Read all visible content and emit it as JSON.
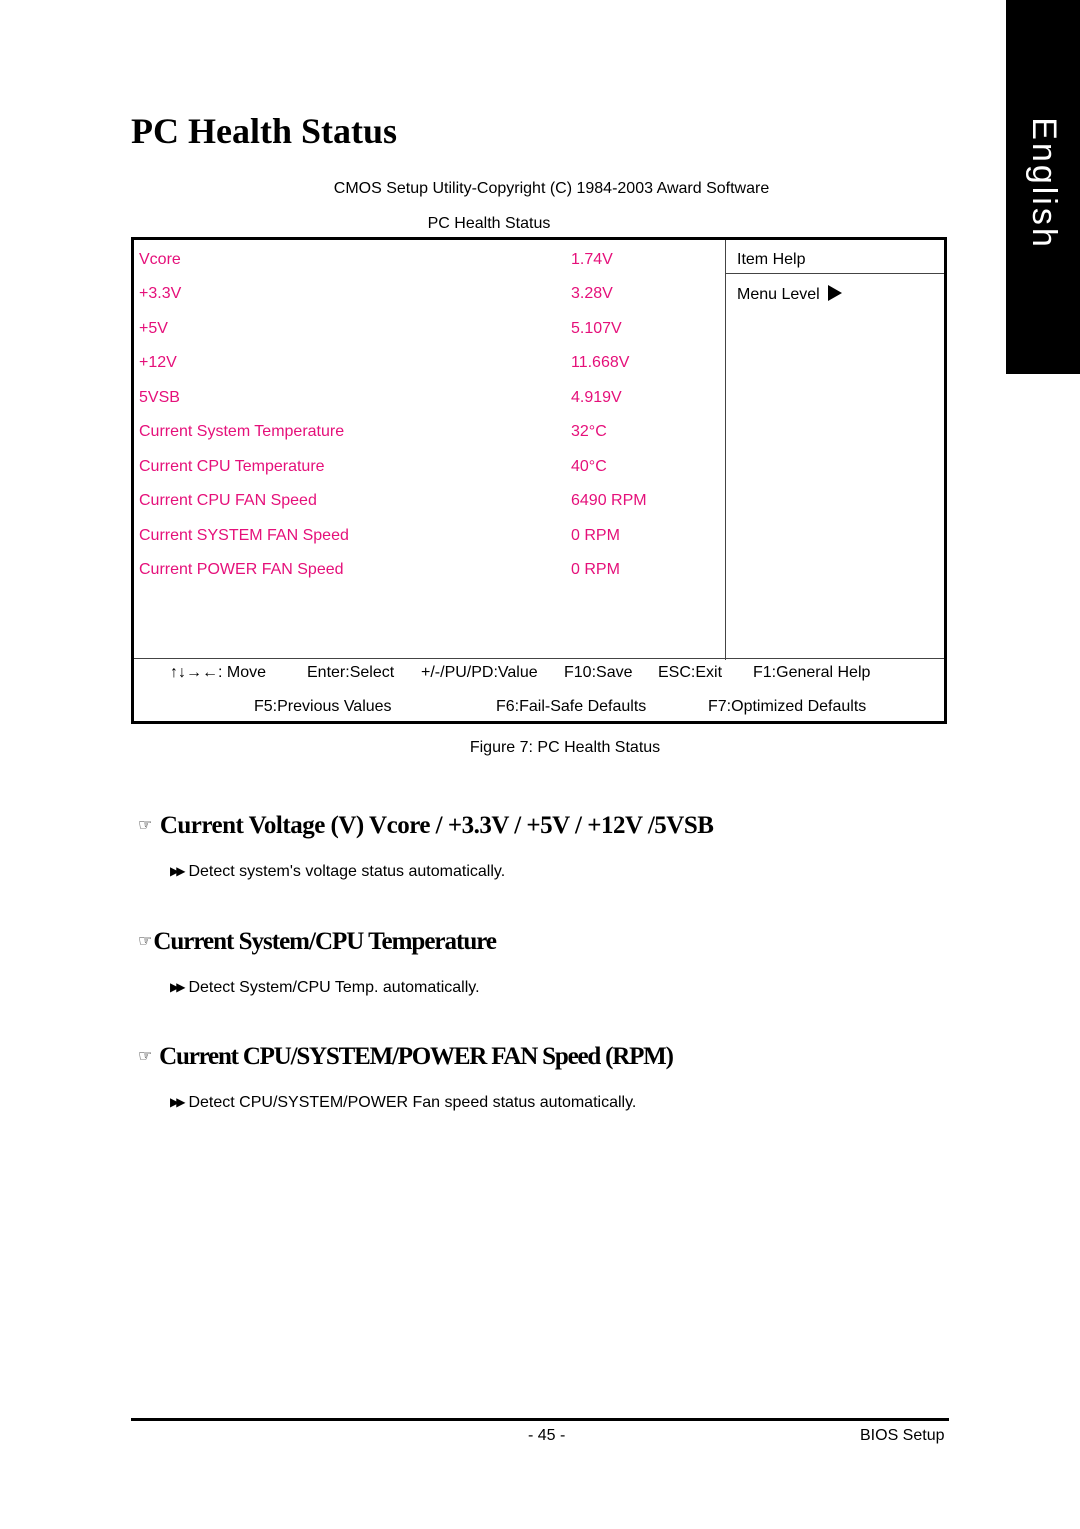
{
  "side_tab": {
    "label": "English"
  },
  "page_title": "PC Health Status",
  "bios": {
    "copyright": "CMOS Setup Utility-Copyright (C) 1984-2003 Award Software",
    "screen_title": "PC Health Status",
    "accent_color": "#e5107a",
    "items": [
      {
        "label": "Vcore",
        "value": "1.74V"
      },
      {
        "label": "+3.3V",
        "value": "3.28V"
      },
      {
        "label": "+5V",
        "value": "5.107V"
      },
      {
        "label": "+12V",
        "value": "11.668V"
      },
      {
        "label": "5VSB",
        "value": "4.919V"
      },
      {
        "label": "Current System Temperature",
        "value": "32°C"
      },
      {
        "label": "Current CPU Temperature",
        "value": "40°C"
      },
      {
        "label": "Current CPU FAN Speed",
        "value": "6490 RPM"
      },
      {
        "label": "Current SYSTEM FAN Speed",
        "value": "0 RPM"
      },
      {
        "label": "Current POWER FAN Speed",
        "value": "0 RPM"
      }
    ],
    "help": {
      "title": "Item Help",
      "menu_level": "Menu Level"
    },
    "footer_line1": {
      "arrows": "↑↓→←",
      "move": ": Move",
      "enter": "Enter:Select",
      "value": "+/-/PU/PD:Value",
      "save": "F10:Save",
      "exit": "ESC:Exit",
      "help": "F1:General Help"
    },
    "footer_line2": {
      "previous": "F5:Previous Values",
      "failsafe": "F6:Fail-Safe Defaults",
      "optimized": "F7:Optimized Defaults"
    }
  },
  "figure_caption": "Figure 7: PC Health Status",
  "sections": [
    {
      "icon": "pointing-hand-icon",
      "heading": "Current Voltage (V) Vcore / +3.3V / +5V / +12V /5VSB",
      "description": "Detect system's voltage status automatically."
    },
    {
      "icon": "pointing-hand-icon",
      "heading": "Current System/CPU Temperature",
      "description": "Detect System/CPU Temp. automatically."
    },
    {
      "icon": "pointing-hand-icon",
      "heading": "Current CPU/SYSTEM/POWER FAN Speed (RPM)",
      "description": "Detect CPU/SYSTEM/POWER Fan speed status automatically."
    }
  ],
  "footer": {
    "page_number": "- 45 -",
    "label": "BIOS Setup"
  }
}
